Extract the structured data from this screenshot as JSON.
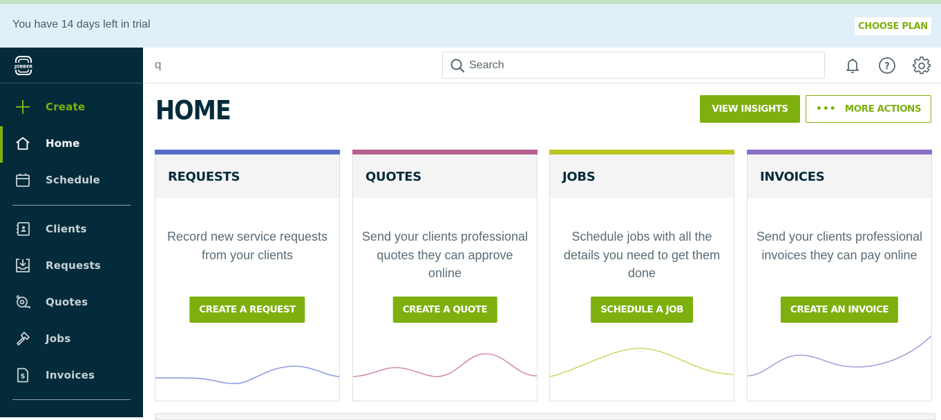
{
  "trial_banner": {
    "message": "You have 14 days left in trial",
    "choose_plan_label": "CHOOSE PLAN"
  },
  "brand": {
    "logo_text": "JOBBER",
    "accent_color": "#7db00e",
    "sidebar_color": "#032b3a"
  },
  "sidebar": {
    "items": [
      {
        "label": "Create",
        "icon": "plus-icon",
        "state": "create"
      },
      {
        "label": "Home",
        "icon": "home-icon",
        "state": "active"
      },
      {
        "label": "Schedule",
        "icon": "calendar-icon",
        "state": "normal"
      },
      {
        "label": "Clients",
        "icon": "address-book-icon",
        "state": "normal"
      },
      {
        "label": "Requests",
        "icon": "inbox-download-icon",
        "state": "normal"
      },
      {
        "label": "Quotes",
        "icon": "measuring-tape-icon",
        "state": "normal"
      },
      {
        "label": "Jobs",
        "icon": "hammer-icon",
        "state": "normal"
      },
      {
        "label": "Invoices",
        "icon": "invoice-dollar-icon",
        "state": "normal"
      }
    ]
  },
  "topbar": {
    "typed_text": "q",
    "search_placeholder": "Search",
    "icons": [
      "bell-icon",
      "help-icon",
      "gear-icon"
    ]
  },
  "page": {
    "title": "HOME",
    "view_insights_label": "VIEW INSIGHTS",
    "more_actions_label": "MORE ACTIONS",
    "more_actions_icon": "•••"
  },
  "cards": [
    {
      "title": "REQUESTS",
      "description": "Record new service requests from your clients",
      "button": "CREATE A REQUEST",
      "color": "#566bcc",
      "wave_color": "#8d9be0"
    },
    {
      "title": "QUOTES",
      "description": "Send your clients professional quotes they can approve online",
      "button": "CREATE A QUOTE",
      "color": "#b5608f",
      "wave_color": "#d08cb3"
    },
    {
      "title": "JOBS",
      "description": "Schedule jobs with all the details you need to get them done",
      "button": "SCHEDULE A JOB",
      "color": "#bbc520",
      "wave_color": "#cfd86a"
    },
    {
      "title": "INVOICES",
      "description": "Send your clients professional invoices they can pay online",
      "button": "CREATE AN INVOICE",
      "color": "#8771c2",
      "wave_color": "#ab9bde"
    }
  ]
}
